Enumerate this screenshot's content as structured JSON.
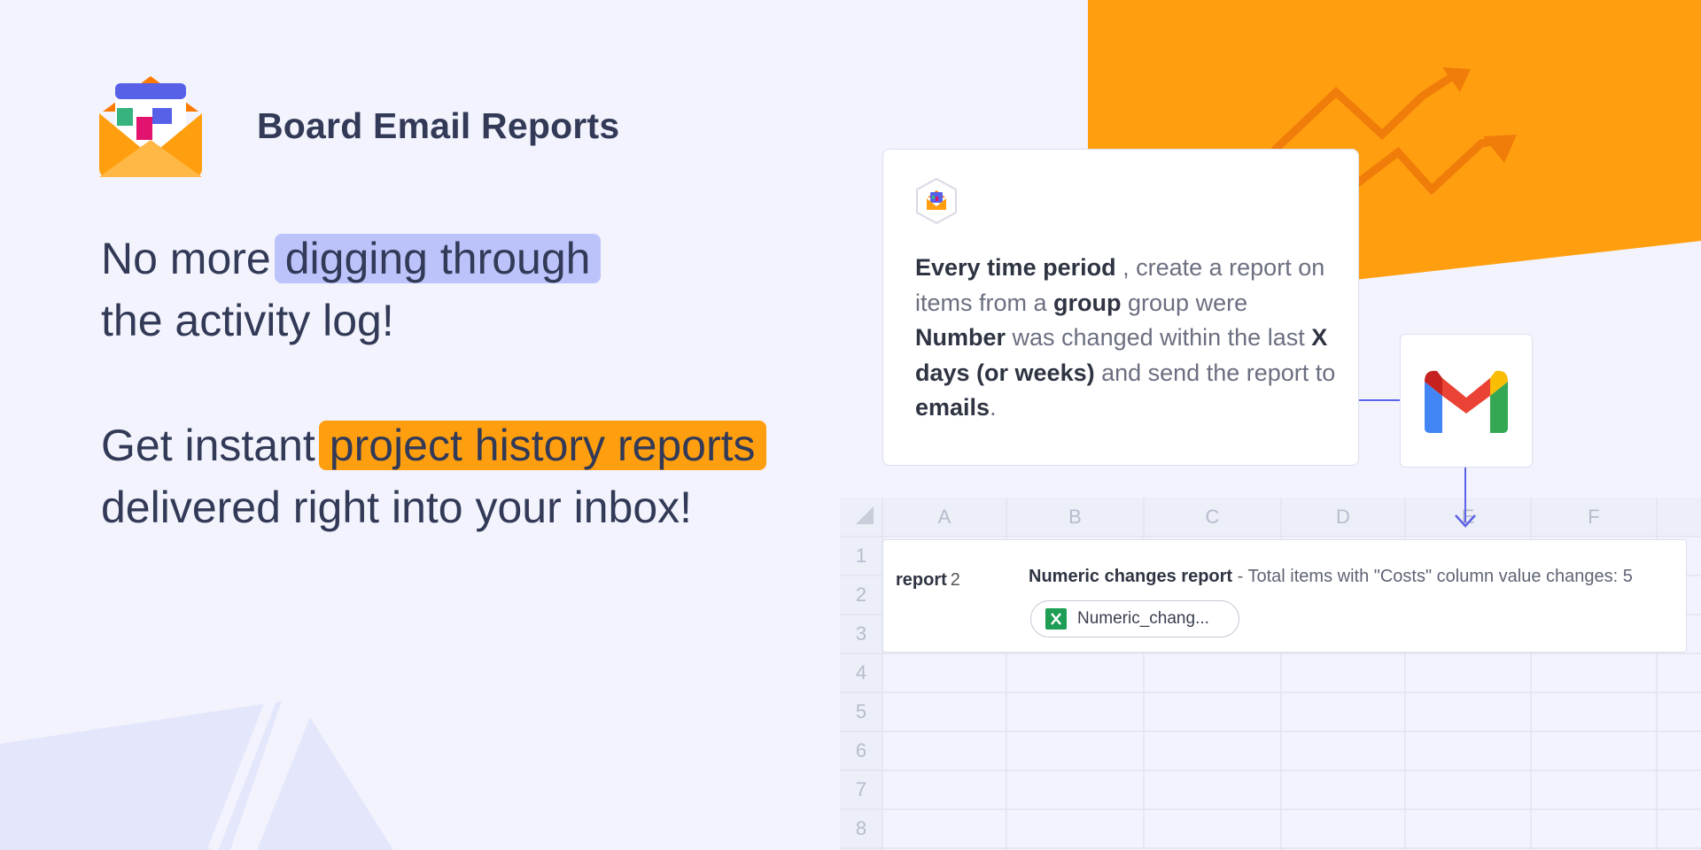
{
  "brand": {
    "title": "Board Email Reports",
    "logo_icon": "open-envelope-report-icon"
  },
  "headline_1": {
    "prefix": "No more",
    "highlight": "digging through",
    "suffix": "the activity log!"
  },
  "headline_2": {
    "prefix": "Get instant",
    "highlight": "project history reports",
    "suffix": "delivered right into your inbox!"
  },
  "automation_card": {
    "icon": "report-app-icon",
    "sentence": [
      {
        "text": "Every time period",
        "bold": true
      },
      {
        "text": " , create a report on items from a ",
        "bold": false
      },
      {
        "text": "group",
        "bold": true
      },
      {
        "text": " group were ",
        "bold": false
      },
      {
        "text": "Number",
        "bold": true
      },
      {
        "text": " was changed within the last ",
        "bold": false
      },
      {
        "text": "X days (or weeks)",
        "bold": true
      },
      {
        "text": " and send the report to ",
        "bold": false
      },
      {
        "text": "emails",
        "bold": true
      },
      {
        "text": ".",
        "bold": false
      }
    ]
  },
  "gmail": {
    "icon": "gmail-icon"
  },
  "spreadsheet": {
    "columns": [
      "A",
      "B",
      "C",
      "D",
      "E",
      "F"
    ],
    "rows": [
      "1",
      "2",
      "3",
      "4",
      "5",
      "6",
      "7",
      "8"
    ]
  },
  "email_report": {
    "label": "report",
    "count": "2",
    "subject_bold": "Numeric changes report",
    "subject_rest": " - Total items with \"Costs\" column value changes: 5",
    "attachment": "Numeric_chang...",
    "attachment_icon": "excel-file-icon"
  },
  "colors": {
    "accent_orange": "#ff9f0f",
    "accent_blue_highlight": "#bcc3fb",
    "connector_blue": "#5b63e6",
    "background": "#f2f3fc",
    "text_dark": "#323a57"
  }
}
